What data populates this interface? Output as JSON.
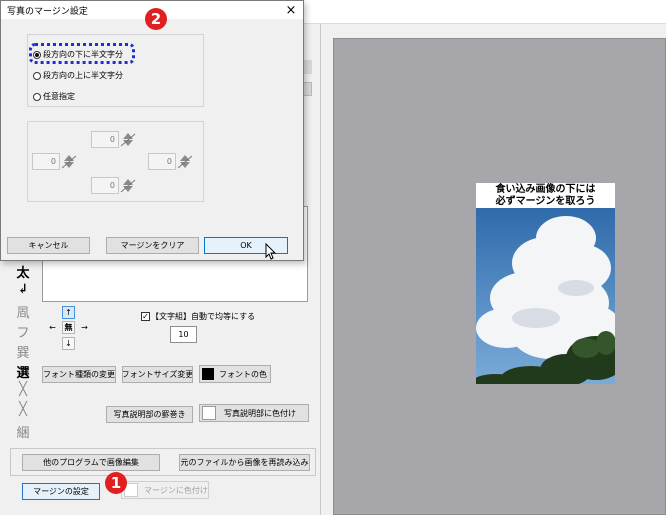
{
  "dialog": {
    "title": "写真のマージン設定",
    "close_glyph": "×",
    "radio_options": [
      {
        "label": "段方向の下に半文字分",
        "selected": true
      },
      {
        "label": "段方向の上に半文字分",
        "selected": false
      },
      {
        "label": "任意指定",
        "selected": false
      }
    ],
    "margins": {
      "top": "0",
      "left": "0",
      "right": "0",
      "bottom": "0"
    },
    "buttons": {
      "cancel": "キャンセル",
      "clear": "マージンをクリア",
      "ok": "OK"
    }
  },
  "badges": {
    "one": "1",
    "two": "2"
  },
  "side_tools": [
    "太",
    "↲",
    "凮",
    "フ",
    "巽",
    "選",
    "╳",
    "╳",
    "綑"
  ],
  "direction_pad": {
    "up": "↑",
    "left": "←",
    "center": "無",
    "right": "→",
    "down": "↓"
  },
  "auto_equal": {
    "label": "【文字組】自動で均等にする",
    "checked": true,
    "value": "10"
  },
  "font_buttons": {
    "type": "フォント種類の変更",
    "size": "フォントサイズ変更",
    "color": "フォントの色"
  },
  "caption_buttons": {
    "enclose": "写真説明部の罫巻き",
    "color": "写真説明部に色付け"
  },
  "bottom_buttons": {
    "edit_other": "他のプログラムで画像編集",
    "reload": "元のファイルから画像を再読み込み",
    "margin_settings": "マージンの設定",
    "margin_color": "マージンに色付け"
  },
  "preview": {
    "caption_line1": "食い込み画像の下には",
    "caption_line2": "必ずマージンを取ろう"
  },
  "colors": {
    "accent_red": "#e02020",
    "focus_dotted": "#1e2fd6",
    "preview_bg": "#a7a6ab"
  }
}
